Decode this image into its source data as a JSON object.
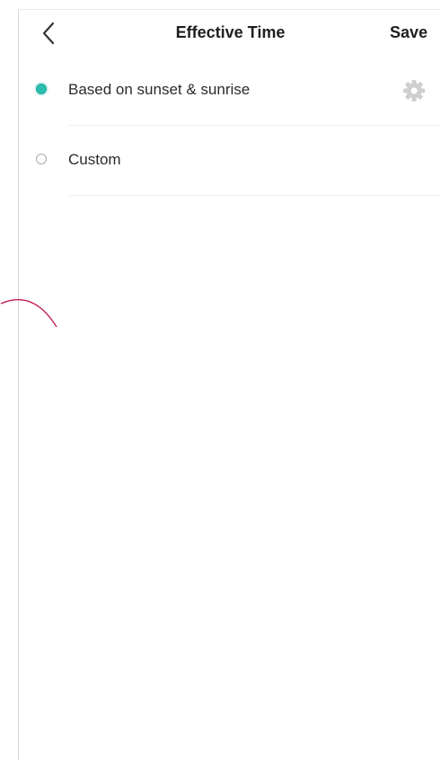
{
  "header": {
    "back_icon": "chevron-left-icon",
    "title": "Effective Time",
    "save_label": "Save"
  },
  "options": [
    {
      "label": "Based on sunset & sunrise",
      "selected": true,
      "settings_icon": "gear-icon"
    },
    {
      "label": "Custom",
      "selected": false
    }
  ],
  "colors": {
    "accent": "#2bbfb0",
    "gear": "#cfcfcf",
    "arc": "#c2185b"
  }
}
